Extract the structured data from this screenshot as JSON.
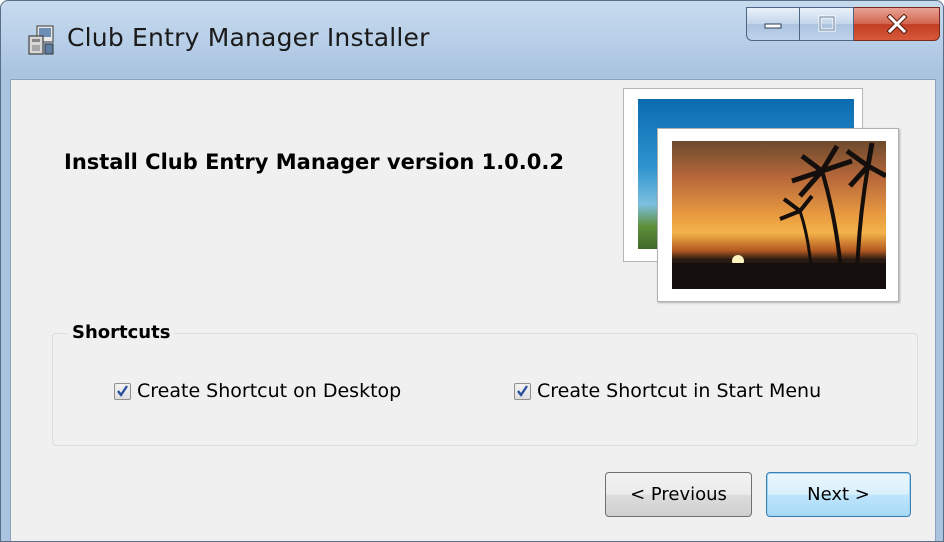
{
  "window": {
    "title": "Club Entry Manager Installer",
    "controls": [
      "minimize",
      "maximize",
      "close"
    ]
  },
  "main": {
    "heading": "Install Club Entry Manager version 1.0.0.2"
  },
  "shortcuts": {
    "group_label": "Shortcuts",
    "desktop": {
      "label": "Create Shortcut on Desktop",
      "checked": true
    },
    "start_menu": {
      "label": "Create Shortcut in Start Menu",
      "checked": true
    }
  },
  "buttons": {
    "previous": "< Previous",
    "next": "Next >"
  },
  "colors": {
    "titlebar": "#b8cfe8",
    "client_bg": "#f0f0f0",
    "close_button": "#c03e22",
    "default_button_border": "#3c7fb1"
  }
}
